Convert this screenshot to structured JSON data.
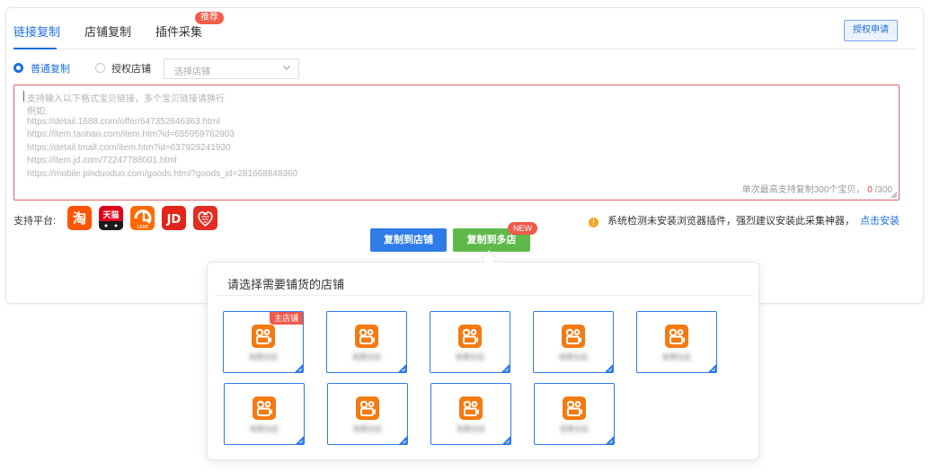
{
  "tabs": [
    {
      "label": "链接复制",
      "active": true
    },
    {
      "label": "店铺复制",
      "active": false
    },
    {
      "label": "插件采集",
      "active": false,
      "badge": "推荐"
    }
  ],
  "auth_button": "授权申请",
  "copy_mode": {
    "normal_label": "普通复制",
    "authorized_label": "授权店铺",
    "selected": "normal",
    "shop_select_placeholder": "选择店铺"
  },
  "link_input": {
    "placeholder_lines": [
      "支持输入以下格式宝贝链接，多个宝贝链接请换行",
      "例如:",
      "https://detail.1688.com/offer/647352646363.html",
      "https://item.taobao.com/item.htm?id=655959762903",
      "https://detail.tmall.com/item.htm?id=637929241930",
      "https://item.jd.com/72247788001.html",
      "https://mobile.pinduoduo.com/goods.html?goods_id=281668848360"
    ],
    "limit_text": "单次最高支持复制300个宝贝，",
    "count": "0",
    "max": "/300"
  },
  "platforms": {
    "label": "支持平台:",
    "items": [
      {
        "name": "taobao",
        "text": "淘",
        "color": "#ff5500"
      },
      {
        "name": "tmall",
        "text": "天猫",
        "color": "#e0001b"
      },
      {
        "name": "1688",
        "text": "1688",
        "color": "#ff6a00"
      },
      {
        "name": "jd",
        "text": "JD",
        "color": "#e1251b"
      },
      {
        "name": "pinduoduo",
        "text": "",
        "color": "#e02e24"
      }
    ]
  },
  "notice": {
    "text": "系统检测未安装浏览器插件，强烈建议安装此采集神器，",
    "link": "点击安装"
  },
  "actions": {
    "copy_to_shop": "复制到店铺",
    "copy_to_multi": "复制到多店",
    "new_badge": "NEW"
  },
  "shop_popup": {
    "title": "请选择需要铺货的店铺",
    "main_tag": "主店铺",
    "shops": [
      {
        "name": "有赞分店",
        "main": true
      },
      {
        "name": "有赞分店"
      },
      {
        "name": "有赞分店"
      },
      {
        "name": "有赞分店"
      },
      {
        "name": "有赞分店"
      },
      {
        "name": "有赞分店"
      },
      {
        "name": "有赞分店"
      },
      {
        "name": "有赞分店"
      },
      {
        "name": "有赞分店"
      }
    ],
    "logo_icon": "kuaishou-logo-icon",
    "logo_color": "#f47a12"
  },
  "colors": {
    "primary": "#1e6fe0",
    "success": "#5fb94a",
    "danger": "#ef5a4b"
  }
}
